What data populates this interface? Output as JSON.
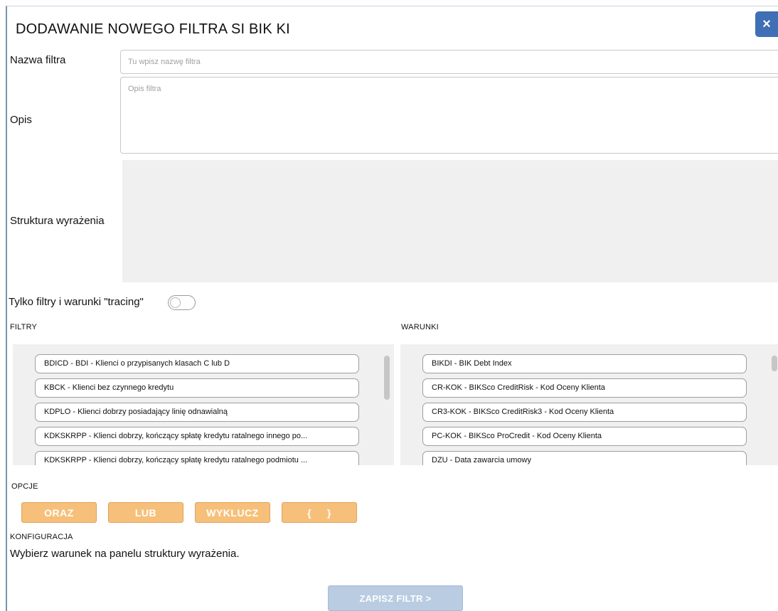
{
  "dialog": {
    "title": "DODAWANIE NOWEGO FILTRA SI BIK KI",
    "close_label": "×"
  },
  "form": {
    "name_label": "Nazwa filtra",
    "name_placeholder": "Tu wpisz nazwę filtra",
    "desc_label": "Opis",
    "desc_placeholder": "Opis filtra",
    "expr_label": "Struktura wyrażenia",
    "tracing_label": "Tylko filtry i warunki \"tracing\"",
    "tracing_on": false
  },
  "filters": {
    "header": "FILTRY",
    "items": [
      "BDICD - BDI - Klienci o przypisanych klasach C lub D",
      "KBCK - Klienci bez czynnego kredytu",
      "KDPLO - Klienci dobrzy posiadający linię odnawialną",
      "KDKSKRPP - Klienci dobrzy, kończący spłatę kredytu ratalnego innego po...",
      "KDKSKRPP - Klienci dobrzy, kończący spłatę kredytu ratalnego podmiotu ..."
    ]
  },
  "conditions": {
    "header": "WARUNKI",
    "items": [
      "BIKDI - BIK Debt Index",
      "CR-KOK - BIKSco CreditRisk - Kod Oceny Klienta",
      "CR3-KOK - BIKSco CreditRisk3 - Kod Oceny Klienta",
      "PC-KOK - BIKSco ProCredit - Kod Oceny Klienta",
      "DZU - Data zawarcia umowy"
    ]
  },
  "options": {
    "header": "OPCJE",
    "and_label": "ORAZ",
    "or_label": "LUB",
    "exclude_label": "WYKLUCZ",
    "brackets_label": "{     }"
  },
  "config": {
    "header": "KONFIGURACJA",
    "hint": "Wybierz warunek na panelu struktury wyrażenia."
  },
  "footer": {
    "save_label": "ZAPISZ FILTR  >"
  }
}
